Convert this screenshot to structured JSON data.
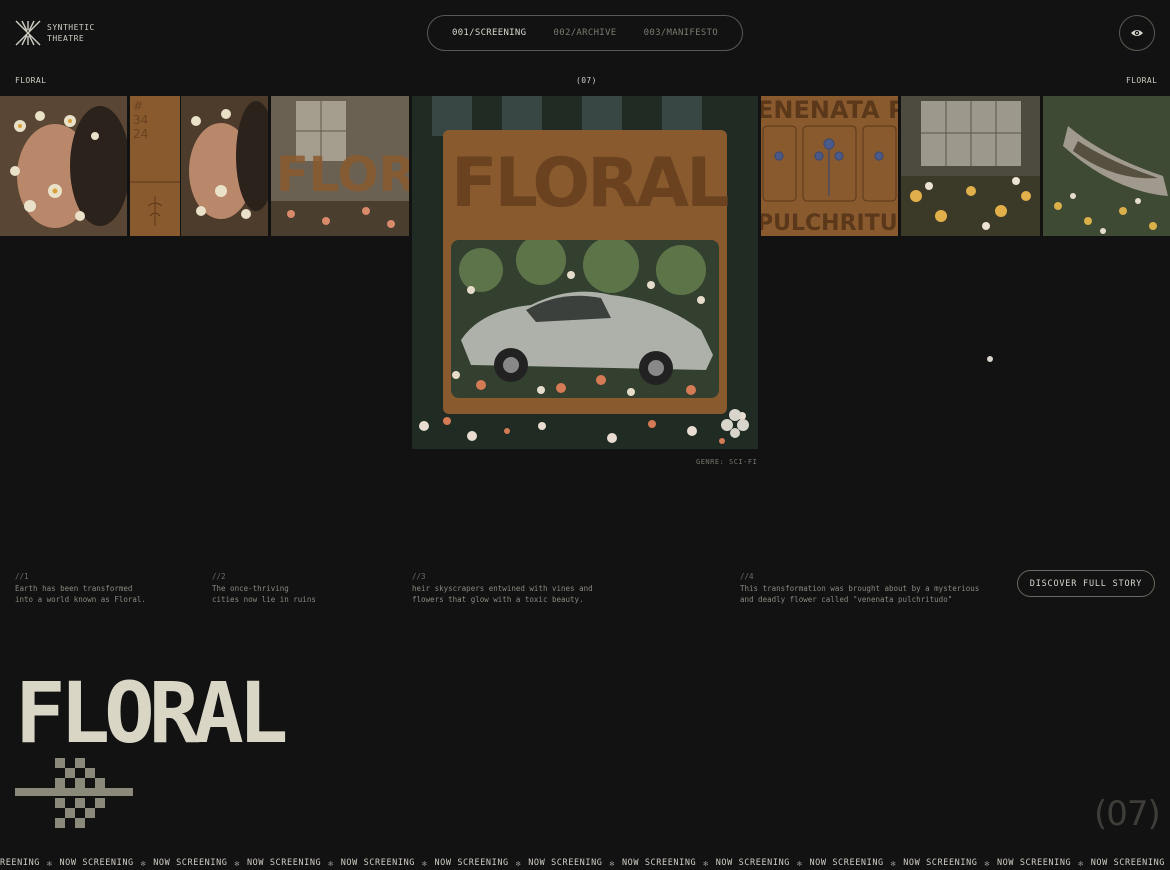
{
  "brand": {
    "line1": "SYNTHETIC",
    "line2": "THEATRE",
    "logo_icon": "starburst-x-icon"
  },
  "nav": {
    "items": [
      {
        "label": "001/SCREENING",
        "active": true
      },
      {
        "label": "002/ARCHIVE",
        "active": false
      },
      {
        "label": "003/MANIFESTO",
        "active": false
      }
    ]
  },
  "visibility_icon": "eye-icon",
  "top": {
    "left_label": "FLORAL",
    "center_label": "(07)",
    "right_label": "FLORAL"
  },
  "poster": {
    "title": "FLORAL",
    "genre": "GENRE: SCI-FI"
  },
  "story": [
    {
      "num": "//1",
      "text": "Earth has been transformed\ninto a world known as Floral."
    },
    {
      "num": "//2",
      "text": "The once-thriving\ncities now lie in ruins"
    },
    {
      "num": "//3",
      "text": "heir skyscrapers entwined with vines and\nflowers that glow with a toxic beauty."
    },
    {
      "num": "//4",
      "text": "This transformation was brought about by a mysterious\nand deadly flower called \"venenata pulchritudo\""
    }
  ],
  "cta": {
    "label": "DISCOVER FULL STORY"
  },
  "title": {
    "text": "FLORAL",
    "counter": "(07)"
  },
  "marquee": {
    "text": "NOW SCREENING",
    "first": "REENING"
  },
  "colors": {
    "background": "#121212",
    "accent": "#8a5a2f",
    "text": "#cfccc3"
  }
}
